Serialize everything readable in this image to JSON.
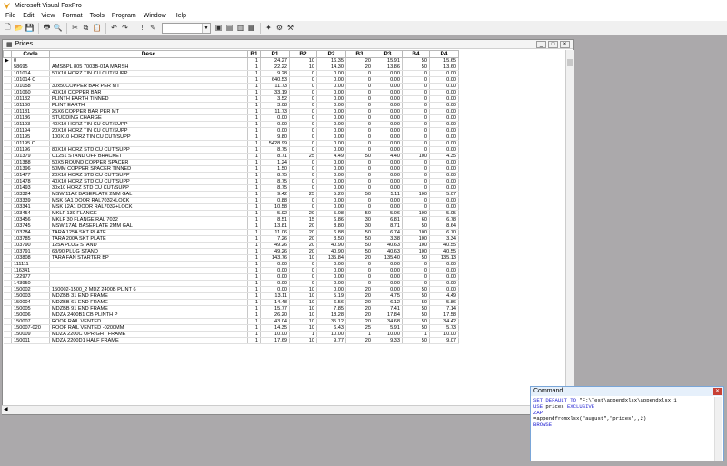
{
  "app": {
    "title": "Microsoft Visual FoxPro"
  },
  "menu": [
    "File",
    "Edit",
    "View",
    "Format",
    "Tools",
    "Program",
    "Window",
    "Help"
  ],
  "toolbar": {
    "icons": [
      "new-icon",
      "open-icon",
      "save-icon",
      "print-icon",
      "print-preview-icon",
      "cut-icon",
      "copy-icon",
      "paste-icon",
      "undo-icon",
      "redo-icon",
      "run-icon",
      "modify-icon",
      "data-session-icon",
      "command-window-icon",
      "view-window-icon",
      "form-wizard-icon",
      "report-wizard-icon",
      "wizard-icon",
      "options-icon"
    ],
    "combo_value": ""
  },
  "browse": {
    "title": "Prices",
    "columns": [
      "",
      "Code",
      "Desc",
      "B1",
      "P1",
      "B2",
      "P2",
      "B3",
      "P3",
      "B4",
      "P4"
    ],
    "rows": [
      [
        "▶",
        "0",
        "",
        "1",
        "24.27",
        "10",
        "16.35",
        "20",
        "15.91",
        "50",
        "15.65"
      ],
      [
        "",
        "58695",
        "AMSBPL 805 7003B-01A MARSH",
        "1",
        "22.22",
        "10",
        "14.30",
        "20",
        "13.86",
        "50",
        "13.60"
      ],
      [
        "",
        "101014",
        "50X10 HORZ TIN CU CUT/SUPP",
        "1",
        "9.28",
        "0",
        "0.00",
        "0",
        "0.00",
        "0",
        "0.00"
      ],
      [
        "",
        "101014 C",
        "",
        "1",
        "640.53",
        "0",
        "0.00",
        "0",
        "0.00",
        "0",
        "0.00"
      ],
      [
        "",
        "101058",
        "30x50COPPER BAR PER MT",
        "1",
        "11.73",
        "0",
        "0.00",
        "0",
        "0.00",
        "0",
        "0.00"
      ],
      [
        "",
        "101060",
        "40X10 COPPER BAR",
        "1",
        "33.19",
        "0",
        "0.00",
        "0",
        "0.00",
        "0",
        "0.00"
      ],
      [
        "",
        "101132",
        "PLINTH EARTH TINNED",
        "1",
        "3.52",
        "0",
        "0.00",
        "0",
        "0.00",
        "0",
        "0.00"
      ],
      [
        "",
        "101160",
        "PLINT EARTH",
        "1",
        "3.08",
        "0",
        "0.00",
        "0",
        "0.00",
        "0",
        "0.00"
      ],
      [
        "",
        "101181",
        "25X6 COPPER BAR PER MT",
        "1",
        "11.73",
        "0",
        "0.00",
        "0",
        "0.00",
        "0",
        "0.00"
      ],
      [
        "",
        "101186",
        "STUDDING CHARGE",
        "1",
        "0.00",
        "0",
        "0.00",
        "0",
        "0.00",
        "0",
        "0.00"
      ],
      [
        "",
        "101193",
        "40X10 HORZ TIN CU CUT/SUPP",
        "1",
        "0.00",
        "0",
        "0.00",
        "0",
        "0.00",
        "0",
        "0.00"
      ],
      [
        "",
        "101194",
        "20X10 HORZ TIN CU CUT/SUPP",
        "1",
        "0.00",
        "0",
        "0.00",
        "0",
        "0.00",
        "0",
        "0.00"
      ],
      [
        "",
        "101195",
        "100X10 HORZ TIN CU CUT/SUPP",
        "1",
        "9.80",
        "0",
        "0.00",
        "0",
        "0.00",
        "0",
        "0.00"
      ],
      [
        "",
        "101195 C",
        "",
        "1",
        "5428.99",
        "0",
        "0.00",
        "0",
        "0.00",
        "0",
        "0.00"
      ],
      [
        "",
        "101196",
        "80X10 HORZ STD CU CUT/SUPP",
        "1",
        "8.75",
        "0",
        "0.00",
        "0",
        "0.00",
        "0",
        "0.00"
      ],
      [
        "",
        "101379",
        "C1251 STAND OFF BRACKET",
        "1",
        "8.71",
        "25",
        "4.49",
        "50",
        "4.40",
        "100",
        "4.35"
      ],
      [
        "",
        "101388",
        "50X5 ROUND COPPER SPACER",
        "1",
        "1.24",
        "0",
        "0.00",
        "0",
        "0.00",
        "0",
        "0.00"
      ],
      [
        "",
        "101396",
        "50MM COPPER SPACER TINNED",
        "1",
        "1.50",
        "0",
        "0.00",
        "0",
        "0.00",
        "0",
        "0.00"
      ],
      [
        "",
        "101477",
        "20X10 HORZ STD CU CUT/SUPP",
        "1",
        "8.75",
        "0",
        "0.00",
        "0",
        "0.00",
        "0",
        "0.00"
      ],
      [
        "",
        "101478",
        "40X10 HORZ STD CU CUT/SUPP",
        "1",
        "8.75",
        "0",
        "0.00",
        "0",
        "0.00",
        "0",
        "0.00"
      ],
      [
        "",
        "101493",
        "30x10 HORZ STD CU CUT/SUPP",
        "1",
        "8.75",
        "0",
        "0.00",
        "0",
        "0.00",
        "0",
        "0.00"
      ],
      [
        "",
        "103324",
        "MSW 11A2 BASEPLATE 2MM GAL",
        "1",
        "9.42",
        "25",
        "5.20",
        "50",
        "5.11",
        "100",
        "5.07"
      ],
      [
        "",
        "103339",
        "MSK 6A1 DOOR RAL7032+LOCK",
        "1",
        "0.88",
        "0",
        "0.00",
        "0",
        "0.00",
        "0",
        "0.00"
      ],
      [
        "",
        "103341",
        "MSK 12A1 DOOR RAL7032+LOCK",
        "1",
        "10.58",
        "0",
        "0.00",
        "0",
        "0.00",
        "0",
        "0.00"
      ],
      [
        "",
        "103454",
        "MKLF 130 FLANGE",
        "1",
        "5.92",
        "20",
        "5.08",
        "50",
        "5.06",
        "100",
        "5.05"
      ],
      [
        "",
        "103456",
        "MKLF 30 FLANGE RAL 7032",
        "1",
        "8.51",
        "15",
        "6.86",
        "30",
        "6.81",
        "60",
        "6.78"
      ],
      [
        "",
        "103745",
        "MSW 17A1 BASEPLATE 2MM GAL",
        "1",
        "13.81",
        "20",
        "8.80",
        "30",
        "8.71",
        "50",
        "8.64"
      ],
      [
        "",
        "103784",
        "TARA 125A SKT PLATE",
        "1",
        "11.06",
        "20",
        "6.88",
        "50",
        "6.74",
        "100",
        "6.70"
      ],
      [
        "",
        "103785",
        "TARA 200A SKT PLATE",
        "1",
        "7.26",
        "20",
        "3.50",
        "50",
        "3.38",
        "100",
        "3.34"
      ],
      [
        "",
        "103790",
        "125A PLUG STAND",
        "1",
        "49.26",
        "20",
        "40.90",
        "50",
        "40.63",
        "100",
        "40.55"
      ],
      [
        "",
        "103791",
        "63/90 PLUG STAND",
        "1",
        "49.26",
        "20",
        "40.90",
        "50",
        "40.63",
        "100",
        "40.55"
      ],
      [
        "",
        "103808",
        "TARA FAN STARTER BP",
        "1",
        "143.76",
        "10",
        "135.84",
        "20",
        "135.40",
        "50",
        "135.13"
      ],
      [
        "",
        "111111",
        "",
        "1",
        "0.00",
        "0",
        "0.00",
        "0",
        "0.00",
        "0",
        "0.00"
      ],
      [
        "",
        "116341",
        "",
        "1",
        "0.00",
        "0",
        "0.00",
        "0",
        "0.00",
        "0",
        "0.00"
      ],
      [
        "",
        "122977",
        "",
        "1",
        "0.00",
        "0",
        "0.00",
        "0",
        "0.00",
        "0",
        "0.00"
      ],
      [
        "",
        "143950",
        "",
        "1",
        "0.00",
        "0",
        "0.00",
        "0",
        "0.00",
        "0",
        "0.00"
      ],
      [
        "",
        "150002",
        "150002-1500_2 MDZ 2400B PLINT 6",
        "1",
        "0.00",
        "10",
        "0.00",
        "20",
        "0.00",
        "50",
        "0.00"
      ],
      [
        "",
        "150003",
        "MDZBB 31 END FRAME",
        "1",
        "13.11",
        "10",
        "5.19",
        "20",
        "4.75",
        "50",
        "4.49"
      ],
      [
        "",
        "150004",
        "MDZBB 61 END FRAME",
        "1",
        "14.48",
        "10",
        "6.56",
        "20",
        "6.12",
        "50",
        "5.86"
      ],
      [
        "",
        "150005",
        "MDZBB 91 END FRAME",
        "1",
        "15.77",
        "10",
        "7.85",
        "20",
        "7.41",
        "50",
        "7.14"
      ],
      [
        "",
        "150006",
        "MDZA 2400B1 CB PLINTH P",
        "1",
        "26.20",
        "10",
        "18.28",
        "20",
        "17.84",
        "50",
        "17.58"
      ],
      [
        "",
        "150007",
        "ROOF RAIL VENTED",
        "1",
        "43.04",
        "10",
        "35.12",
        "20",
        "34.68",
        "50",
        "34.42"
      ],
      [
        "",
        "150007-020",
        "ROOF RAIL VENTED -0200MM",
        "1",
        "14.35",
        "10",
        "6.43",
        "25",
        "5.91",
        "50",
        "5.73"
      ],
      [
        "",
        "150009",
        "MDZA 2200C UPRIGHT FRAME",
        "1",
        "10.00",
        "1",
        "10.00",
        "1",
        "10.00",
        "1",
        "10.00"
      ],
      [
        "",
        "150011",
        "MDZA 2200D1 HALF FRAME",
        "1",
        "17.69",
        "10",
        "9.77",
        "20",
        "9.33",
        "50",
        "9.07"
      ]
    ]
  },
  "command": {
    "title": "Command",
    "lines": [
      {
        "kw": "SET DEFAULT TO",
        "rest": " \"F:\\Test\\appendxlsx\\appendxlsx 1"
      },
      {
        "kw": "USE",
        "rest": " prices ",
        "kw2": "EXCLUSIVE"
      },
      {
        "kw": "ZAP",
        "rest": ""
      },
      {
        "kw": "",
        "rest": "=appendfromxlsx(\"august\",\"prices\",,2)"
      },
      {
        "kw": "BROWSE",
        "rest": ""
      }
    ]
  }
}
